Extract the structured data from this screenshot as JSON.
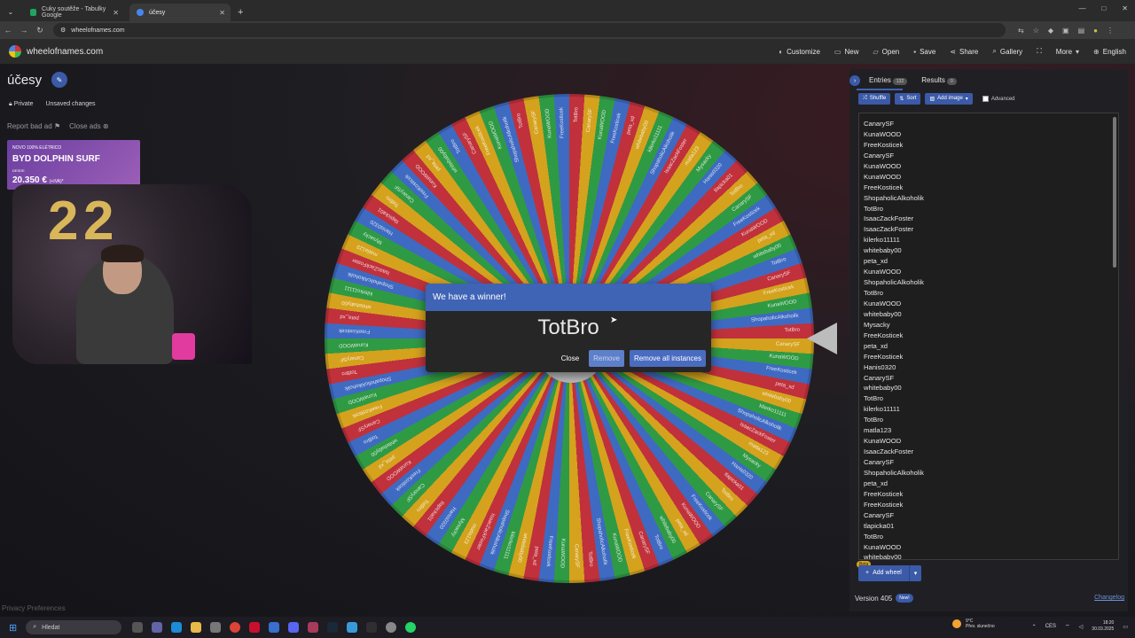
{
  "browser": {
    "tabs": [
      {
        "title": "Cuky soutěže - Tabulky Google",
        "color": "#1fa463",
        "active": false
      },
      {
        "title": "účesy",
        "color": "#4885ed",
        "active": true
      }
    ],
    "url": "wheelofnames.com"
  },
  "site": {
    "name": "wheelofnames.com",
    "menu": [
      {
        "icon": "palette-icon",
        "label": "Customize"
      },
      {
        "icon": "new-file-icon",
        "label": "New"
      },
      {
        "icon": "folder-open-icon",
        "label": "Open"
      },
      {
        "icon": "save-icon",
        "label": "Save"
      },
      {
        "icon": "share-icon",
        "label": "Share"
      },
      {
        "icon": "search-icon",
        "label": "Gallery"
      },
      {
        "icon": "fullscreen-icon",
        "label": ""
      },
      {
        "icon": "chevron-down-icon",
        "label": "More"
      },
      {
        "icon": "globe-icon",
        "label": "English"
      }
    ]
  },
  "left": {
    "title": "účesy",
    "privacy": "Private",
    "unsaved": "Unsaved changes",
    "report_ad": "Report bad ad",
    "close_ads": "Close ads",
    "ad": {
      "small": "NOVO 100% ELÉTRICO",
      "big": "BYD DOLPHIN SURF",
      "note": "DESDE",
      "price": "20.350 €",
      "suffix": "(+IVA)*"
    },
    "privacy_prefs": "Privacy Preferences"
  },
  "dialog": {
    "header": "We have a winner!",
    "winner": "TotBro",
    "close": "Close",
    "remove": "Remove",
    "remove_all": "Remove all instances"
  },
  "panel": {
    "entries_tab": "Entries",
    "entries_count": "132",
    "results_tab": "Results",
    "results_count": "0",
    "shuffle": "Shuffle",
    "sort": "Sort",
    "add_image": "Add image",
    "advanced": "Advanced",
    "entries": [
      "CanarySF",
      "KunaWOOD",
      "FreeKosticek",
      "CanarySF",
      "KunaWOOD",
      "KunaWOOD",
      "FreeKosticek",
      "ShopaholicAlkoholik",
      "TotBro",
      "IsaacZackFoster",
      "IsaacZackFoster",
      "kilerko11111",
      "whitebaby00",
      "peta_xd",
      "KunaWOOD",
      "ShopaholicAlkoholik",
      "TotBro",
      "KunaWOOD",
      "whitebaby00",
      "Mysacky",
      "FreeKosticek",
      "peta_xd",
      "FreeKosticek",
      "Hanis0320",
      "CanarySF",
      "whitebaby00",
      "TotBro",
      "kilerko11111",
      "TotBro",
      "matla123",
      "KunaWOOD",
      "IsaacZackFoster",
      "CanarySF",
      "ShopaholicAlkoholik",
      "peta_xd",
      "FreeKosticek",
      "FreeKosticek",
      "CanarySF",
      "tlapicka01",
      "TotBro",
      "KunaWOOD",
      "whitebaby00"
    ],
    "beta": "Beta",
    "add_wheel": "Add wheel",
    "version": "Version 405",
    "new_badge": "New!",
    "changelog": "Changelog"
  },
  "wheel_labels": [
    "TotBro",
    "CanarySF",
    "KunaWOOD",
    "FreeKosticek",
    "peta_xd",
    "whitebaby00",
    "kilerko11111",
    "ShopaholicAlkoholik",
    "IsaacZackFoster",
    "matla123",
    "Mysacky",
    "Hanis0320",
    "tlapicka01",
    "TotBro",
    "CanarySF",
    "FreeKosticek",
    "KunaWOOD",
    "peta_xd",
    "whitebaby00",
    "TotBro",
    "CanarySF",
    "FreeKosticek",
    "KunaWOOD",
    "ShopaholicAlkoholik"
  ],
  "taskbar": {
    "search": "Hledat",
    "weather_temp": "9°C",
    "weather_desc": "Přev. slunečno",
    "lang": "CES",
    "time": "18:20",
    "date": "30.03.2025"
  }
}
